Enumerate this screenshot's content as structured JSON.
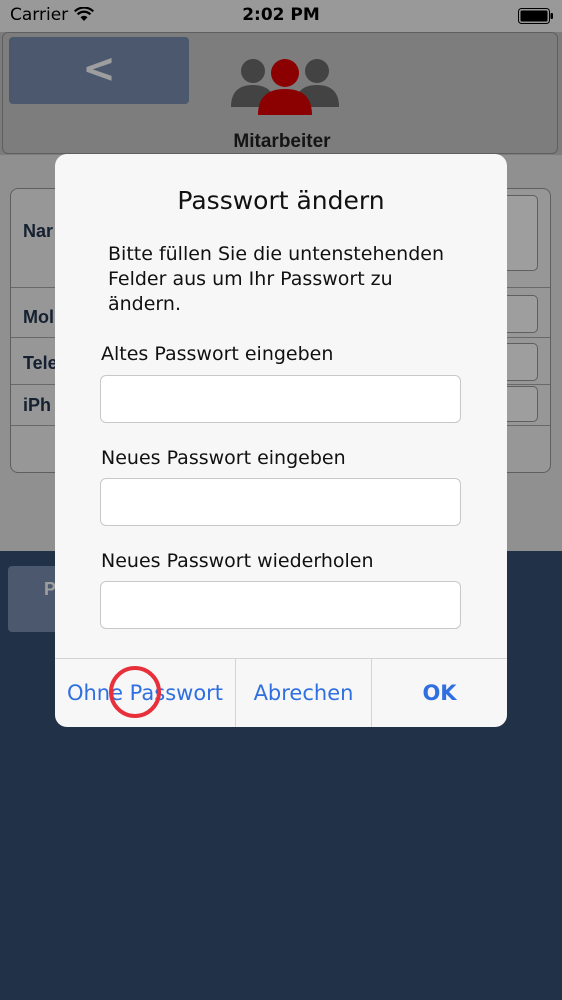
{
  "status_bar": {
    "carrier": "Carrier",
    "time": "2:02 PM"
  },
  "header": {
    "back_label": "<",
    "title": "Mitarbeiter",
    "icon": "staff-group-icon",
    "icon_accent": "#e00000"
  },
  "background_form": {
    "rows": [
      "Nar",
      "Mol",
      "Tele",
      "iPh"
    ],
    "bottom_button_label": "P"
  },
  "dialog": {
    "title": "Passwort ändern",
    "message": "Bitte füllen Sie die untenstehenden Felder aus um Ihr Passwort zu ändern.",
    "fields": [
      {
        "label": "Altes Passwort eingeben",
        "value": ""
      },
      {
        "label": "Neues Passwort eingeben",
        "value": ""
      },
      {
        "label": "Neues Passwort wiederholen",
        "value": ""
      }
    ],
    "buttons": {
      "no_password": "Ohne Passwort",
      "cancel": "Abrechen",
      "ok": "OK"
    }
  },
  "colors": {
    "background": "#354f75",
    "button_text": "#2f6fe0",
    "tap_marker": "#e8303a"
  }
}
